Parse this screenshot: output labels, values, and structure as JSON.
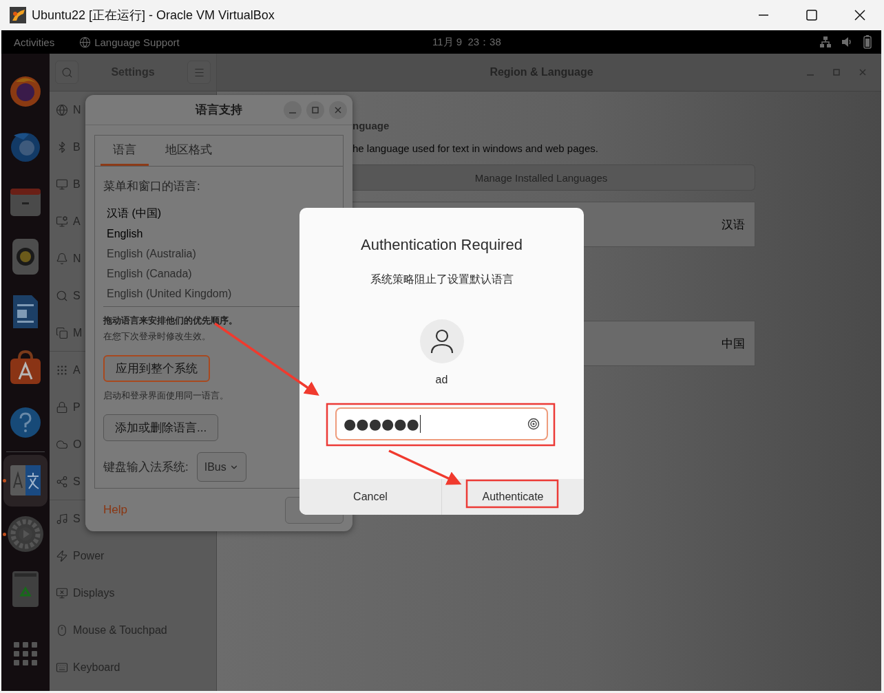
{
  "app_window": {
    "title": "Ubuntu22 [正在运行] - Oracle VM VirtualBox"
  },
  "top_bar": {
    "activities": "Activities",
    "app_menu": "Language Support",
    "clock": "11月 9  23：38"
  },
  "dock": [
    {
      "running": false,
      "selected": false
    },
    {
      "running": false,
      "selected": false
    },
    {
      "running": false,
      "selected": false
    },
    {
      "running": false,
      "selected": false
    },
    {
      "running": false,
      "selected": false
    },
    {
      "running": false,
      "selected": false
    },
    {
      "running": false,
      "selected": false
    },
    {
      "running": true,
      "selected": true
    },
    {
      "running": true,
      "selected": false
    },
    {
      "running": false,
      "selected": false
    },
    {
      "running": false,
      "selected": false
    }
  ],
  "settings": {
    "title": "Settings",
    "panel_title": "Region & Language",
    "sidebar": [
      {
        "label": "N"
      },
      {
        "label": "B"
      },
      {
        "label": "B"
      },
      {
        "label": "A"
      },
      {
        "label": "N"
      },
      {
        "label": "S"
      },
      {
        "label": "M"
      },
      {
        "label": "A"
      },
      {
        "label": "P"
      },
      {
        "label": "O"
      },
      {
        "label": "S"
      },
      {
        "label": "S"
      },
      {
        "label": "Power"
      },
      {
        "label": "Displays"
      },
      {
        "label": "Mouse & Touchpad"
      },
      {
        "label": "Keyboard"
      }
    ],
    "section_heading": "nguage",
    "section_subtitle": "he language used for text in windows and web pages.",
    "manage_button": "Manage Installed Languages",
    "rows": [
      {
        "value": "汉语"
      },
      {
        "value": "中国"
      }
    ]
  },
  "language_dialog": {
    "title": "语言支持",
    "tabs": [
      {
        "label": "语言",
        "selected": true
      },
      {
        "label": "地区格式",
        "selected": false
      }
    ],
    "list_label": "菜单和窗口的语言:",
    "languages": [
      {
        "name": "汉语 (中国)",
        "disabled": false
      },
      {
        "name": "English",
        "disabled": false
      },
      {
        "name": "English (Australia)",
        "disabled": true
      },
      {
        "name": "English (Canada)",
        "disabled": true
      },
      {
        "name": "English (United Kingdom)",
        "disabled": true
      }
    ],
    "drag_hint": "拖动语言来安排他们的优先顺序。",
    "drag_note": "在您下次登录时修改生效。",
    "apply_button": "应用到整个系统",
    "apply_note": "启动和登录界面使用同一语言。",
    "add_button": "添加或删除语言...",
    "input_label": "键盘输入法系统:",
    "input_system": "IBus",
    "help": "Help"
  },
  "auth_dialog": {
    "title": "Authentication Required",
    "message": "系统策略阻止了设置默认语言",
    "user": "ad",
    "password": "●●●●●●",
    "buttons": [
      {
        "label": "Cancel"
      },
      {
        "label": "Authenticate"
      }
    ]
  }
}
